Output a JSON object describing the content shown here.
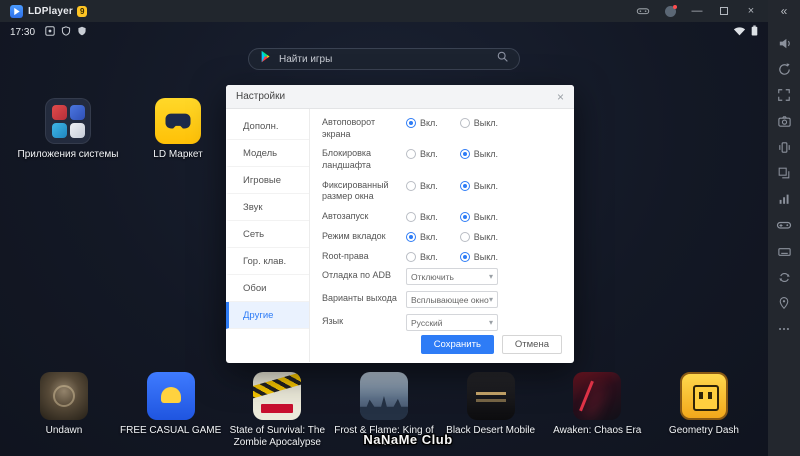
{
  "titlebar": {
    "app_name": "LDPlayer",
    "version_badge": "9"
  },
  "icons": {
    "minimize": "—",
    "close": "×",
    "collapse": "«",
    "chevron_down": "▾",
    "dialog_close": "×"
  },
  "statusbar": {
    "time": "17:30"
  },
  "search": {
    "label": "Найти игры"
  },
  "desktop_apps": [
    {
      "label": "Приложения системы"
    },
    {
      "label": "LD Маркет"
    }
  ],
  "dialog": {
    "title": "Настройки",
    "tabs": [
      {
        "label": "Дополн."
      },
      {
        "label": "Модель"
      },
      {
        "label": "Игровые"
      },
      {
        "label": "Звук"
      },
      {
        "label": "Сеть"
      },
      {
        "label": "Гор. клав."
      },
      {
        "label": "Обои"
      },
      {
        "label": "Другие"
      }
    ],
    "active_tab_index": 7,
    "on_label": "Вкл.",
    "off_label": "Выкл.",
    "radio_rows": [
      {
        "label": "Автоповорот экрана",
        "value": "on"
      },
      {
        "label": "Блокировка ландшафта",
        "value": "off"
      },
      {
        "label": "Фиксированный размер окна",
        "value": "off"
      },
      {
        "label": "Автозапуск",
        "value": "off"
      },
      {
        "label": "Режим вкладок",
        "value": "on"
      },
      {
        "label": "Root-права",
        "value": "off"
      }
    ],
    "select_rows": [
      {
        "label": "Отладка по ADB",
        "value": "Отключить"
      },
      {
        "label": "Варианты выхода",
        "value": "Всплывающее окно"
      },
      {
        "label": "Язык",
        "value": "Русский"
      }
    ],
    "save_label": "Сохранить",
    "cancel_label": "Отмена"
  },
  "dock_games": [
    {
      "label": "Undawn"
    },
    {
      "label": "FREE CASUAL GAME"
    },
    {
      "label": "State of Survival: The Zombie Apocalypse"
    },
    {
      "label": "Frost & Flame: King of Avalon"
    },
    {
      "label": "Black Desert Mobile"
    },
    {
      "label": "Awaken: Chaos Era"
    },
    {
      "label": "Geometry Dash"
    }
  ],
  "watermark": "NaNaMe Club"
}
